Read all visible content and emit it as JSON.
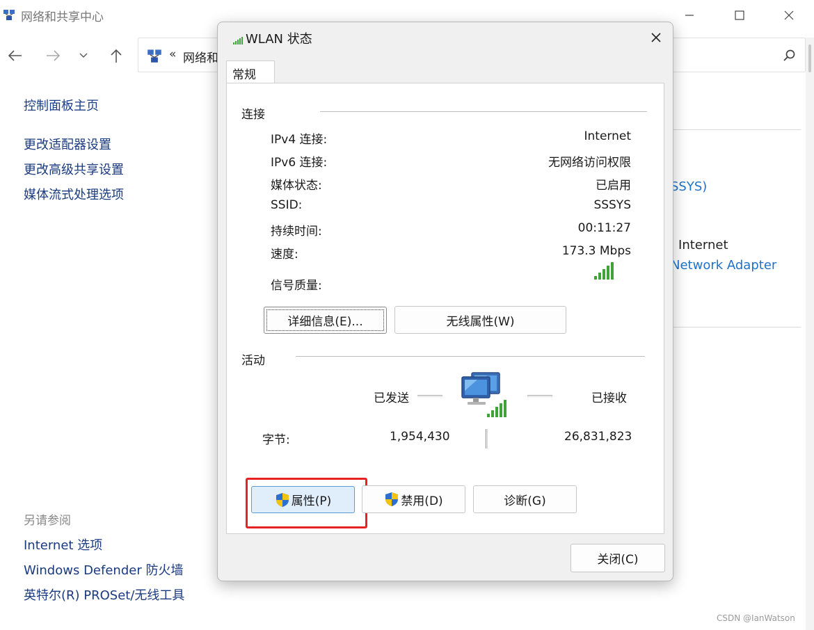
{
  "background_window": {
    "title": "网络和共享中心",
    "address_chevron": "«",
    "address_text": "网络和",
    "sidebar": {
      "home": "控制面板主页",
      "links": [
        "更改适配器设置",
        "更改高级共享设置",
        "媒体流式处理选项"
      ],
      "see_also_title": "另请参阅",
      "see_also": [
        "Internet 选项",
        "Windows Defender 防火墙",
        "英特尔(R) PROSet/无线工具"
      ]
    },
    "fragments": {
      "network_name": "SSYS)",
      "access": "J Internet",
      "adapter": "Network Adapter"
    },
    "watermark": "CSDN @IanWatson"
  },
  "dialog": {
    "title": "WLAN 状态",
    "tab": "常规",
    "connection": {
      "group_label": "连接",
      "rows": [
        {
          "label": "IPv4 连接:",
          "value": "Internet"
        },
        {
          "label": "IPv6 连接:",
          "value": "无网络访问权限"
        },
        {
          "label": "媒体状态:",
          "value": "已启用"
        },
        {
          "label": "SSID:",
          "value": "SSSYS"
        },
        {
          "label": "持续时间:",
          "value": "00:11:27"
        },
        {
          "label": "速度:",
          "value": "173.3 Mbps"
        }
      ],
      "signal_label": "信号质量:",
      "signal_bars": 5,
      "details_button": "详细信息(E)...",
      "wireless_button": "无线属性(W)"
    },
    "activity": {
      "group_label": "活动",
      "sent_label": "已发送",
      "received_label": "已接收",
      "bytes_label": "字节:",
      "bytes_sent": "1,954,430",
      "bytes_received": "26,831,823"
    },
    "buttons": {
      "properties": "属性(P)",
      "disable": "禁用(D)",
      "diagnose": "诊断(G)",
      "close": "关闭(C)"
    }
  },
  "colors": {
    "link": "#1a3a80",
    "accent_blue": "#1f72c9",
    "highlight_red": "#e62222",
    "signal_green": "#3fa33a",
    "dialog_bg": "#f0f0f0"
  }
}
